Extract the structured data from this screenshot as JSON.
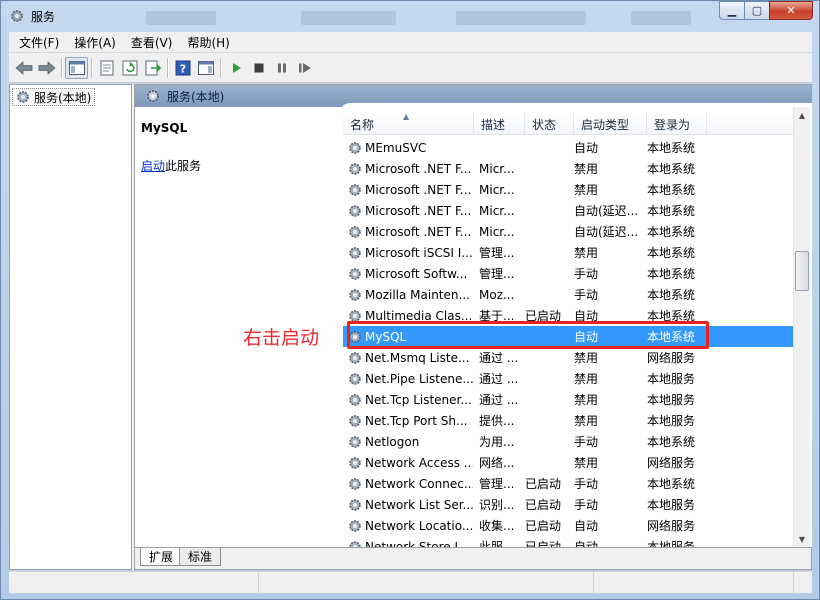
{
  "window": {
    "title": "服务"
  },
  "menu": [
    "文件(F)",
    "操作(A)",
    "查看(V)",
    "帮助(H)"
  ],
  "tree": {
    "root_label": "服务(本地)"
  },
  "pane": {
    "header": "服务(本地)",
    "selected_name": "MySQL",
    "action_link": "启动",
    "action_suffix": "此服务"
  },
  "columns": {
    "name": "名称",
    "desc": "描述",
    "status": "状态",
    "startup": "启动类型",
    "logon": "登录为"
  },
  "services": [
    {
      "name": "MEmuSVC",
      "desc": "",
      "status": "",
      "startup": "自动",
      "logon": "本地系统"
    },
    {
      "name": "Microsoft .NET F...",
      "desc": "Micr...",
      "status": "",
      "startup": "禁用",
      "logon": "本地系统"
    },
    {
      "name": "Microsoft .NET F...",
      "desc": "Micr...",
      "status": "",
      "startup": "禁用",
      "logon": "本地系统"
    },
    {
      "name": "Microsoft .NET F...",
      "desc": "Micr...",
      "status": "",
      "startup": "自动(延迟...",
      "logon": "本地系统"
    },
    {
      "name": "Microsoft .NET F...",
      "desc": "Micr...",
      "status": "",
      "startup": "自动(延迟...",
      "logon": "本地系统"
    },
    {
      "name": "Microsoft iSCSI I...",
      "desc": "管理...",
      "status": "",
      "startup": "禁用",
      "logon": "本地系统"
    },
    {
      "name": "Microsoft Softw...",
      "desc": "管理...",
      "status": "",
      "startup": "手动",
      "logon": "本地系统"
    },
    {
      "name": "Mozilla Mainten...",
      "desc": "Moz...",
      "status": "",
      "startup": "手动",
      "logon": "本地系统"
    },
    {
      "name": "Multimedia Clas...",
      "desc": "基于...",
      "status": "已启动",
      "startup": "自动",
      "logon": "本地系统"
    },
    {
      "name": "MySQL",
      "desc": "",
      "status": "",
      "startup": "自动",
      "logon": "本地系统",
      "selected": true
    },
    {
      "name": "Net.Msmq Liste...",
      "desc": "通过 ...",
      "status": "",
      "startup": "禁用",
      "logon": "网络服务"
    },
    {
      "name": "Net.Pipe Listene...",
      "desc": "通过 ...",
      "status": "",
      "startup": "禁用",
      "logon": "本地服务"
    },
    {
      "name": "Net.Tcp Listener...",
      "desc": "通过 ...",
      "status": "",
      "startup": "禁用",
      "logon": "本地服务"
    },
    {
      "name": "Net.Tcp Port Sh...",
      "desc": "提供...",
      "status": "",
      "startup": "禁用",
      "logon": "本地服务"
    },
    {
      "name": "Netlogon",
      "desc": "为用...",
      "status": "",
      "startup": "手动",
      "logon": "本地系统"
    },
    {
      "name": "Network Access ...",
      "desc": "网络...",
      "status": "",
      "startup": "禁用",
      "logon": "网络服务"
    },
    {
      "name": "Network Connec...",
      "desc": "管理...",
      "status": "已启动",
      "startup": "手动",
      "logon": "本地系统"
    },
    {
      "name": "Network List Ser...",
      "desc": "识别...",
      "status": "已启动",
      "startup": "手动",
      "logon": "本地服务"
    },
    {
      "name": "Network Locatio...",
      "desc": "收集...",
      "status": "已启动",
      "startup": "自动",
      "logon": "网络服务"
    },
    {
      "name": "Network Store I...",
      "desc": "此服...",
      "status": "已启动",
      "startup": "自动",
      "logon": "本地服务"
    }
  ],
  "tabs": {
    "extended": "扩展",
    "standard": "标准"
  },
  "annotation": {
    "text": "右击启动",
    "color": "#ef2a2a"
  },
  "colors": {
    "selection": "#3399ff",
    "highlight_border": "#e8231f",
    "link": "#0033cc"
  }
}
